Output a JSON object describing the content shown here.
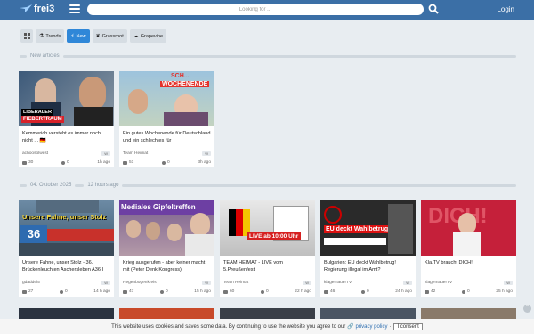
{
  "header": {
    "logo_text": "frei3",
    "search_placeholder": "Looking for ...",
    "login_label": "Login",
    "bg_color": "#3b6fa6"
  },
  "filters": [
    {
      "label": "",
      "icon": "grid-icon",
      "active": false
    },
    {
      "label": "Trends",
      "icon": "flask-icon",
      "active": false
    },
    {
      "label": "New",
      "icon": "bolt-icon",
      "active": true
    },
    {
      "label": "Grassroot",
      "icon": "leaf-icon",
      "active": false
    },
    {
      "label": "Grapevine",
      "icon": "chat-icon",
      "active": false
    }
  ],
  "sections": {
    "new_articles": "New articles",
    "date_label": "04. Oktober 2025",
    "ago_label": "12 hours ago"
  },
  "new_cards": [
    {
      "title": "Kemmerich versteht es immer noch nicht ... 🇩🇪",
      "channel": "achoosolwest",
      "badge": "W",
      "views": "30",
      "comments": "0",
      "age": "1h ago",
      "thumb_text": "LIBERALER FIEBERTRAUM"
    },
    {
      "title": "Ein gutes Wochenende für Deutschland und ein schlechtes für",
      "channel": "Team Heimat",
      "badge": "W",
      "views": "51",
      "comments": "0",
      "age": "3h ago",
      "thumb_text": "SCH... WOCHENENDE"
    }
  ],
  "day_cards": [
    {
      "title": "Unsere Fahne, unser Stolz - 36. Brückenleuchten Aschersleben A36 I",
      "channel": "gdaddel5",
      "badge": "W",
      "views": "27",
      "comments": "0",
      "age": "14 h ago",
      "thumb_text": "Unsere Fahne, unser Stolz"
    },
    {
      "title": "Krieg ausgerufen - aber keiner macht mit (Peter Denk Kongress)",
      "channel": "Regenbogenkreis",
      "badge": "W",
      "views": "47",
      "comments": "0",
      "age": "15 h ago",
      "thumb_text": "Mediales Gipfeltreffen"
    },
    {
      "title": "TEAM HEIMAT - LIVE vom 5.Preußenfest",
      "channel": "Team Heimat",
      "badge": "W",
      "views": "60",
      "comments": "0",
      "age": "22 h ago",
      "thumb_text": "LIVE ab 10:00 Uhr"
    },
    {
      "title": "Bulgarien: EU deckt Wahlbetrug! Regierung illegal im Amt?",
      "channel": "klagemauerTV",
      "badge": "W",
      "views": "46",
      "comments": "0",
      "age": "24 h ago",
      "thumb_text": "EU deckt Wahlbetrug"
    },
    {
      "title": "Kla.TV braucht DICH!",
      "channel": "klagemauerTV",
      "badge": "W",
      "views": "42",
      "comments": "0",
      "age": "25 h ago",
      "thumb_text": "DICH!"
    }
  ],
  "cookie": {
    "text_before": "This website uses cookies and saves some data. By continuing to use the website you agree to our",
    "privacy": "privacy policy",
    "ok": "I consent"
  },
  "scroll_top": "⌃"
}
